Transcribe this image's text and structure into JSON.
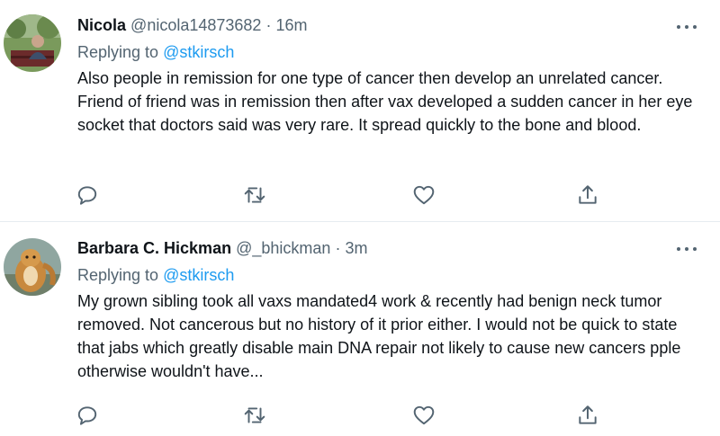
{
  "tweets": [
    {
      "name": "Nicola",
      "handle": "@nicola14873682",
      "separator": "·",
      "time": "16m",
      "replying_prefix": "Replying to",
      "replying_to": "@stkirsch",
      "text": "Also people in remission for one type of cancer then develop an unrelated cancer. Friend of friend was in remission then after vax developed a sudden cancer in her eye socket that doctors said was very rare. It spread quickly to the bone and blood.",
      "icons": {
        "more": "more-options-icon",
        "reply": "reply-icon",
        "retweet": "retweet-icon",
        "like": "heart-icon",
        "share": "share-icon"
      }
    },
    {
      "name": "Barbara C. Hickman",
      "handle": "@_bhickman",
      "separator": "·",
      "time": "3m",
      "replying_prefix": "Replying to",
      "replying_to": "@stkirsch",
      "text": "My grown sibling took all vaxs mandated4 work & recently had benign neck tumor removed. Not cancerous but no history of it prior either. I would not be quick to state that jabs which greatly disable main DNA repair not likely to cause new cancers pple otherwise wouldn't have...",
      "icons": {
        "more": "more-options-icon",
        "reply": "reply-icon",
        "retweet": "retweet-icon",
        "like": "heart-icon",
        "share": "share-icon"
      }
    }
  ],
  "colors": {
    "text": "#0f1419",
    "secondary": "#536471",
    "accent": "#1d9bf0",
    "divider": "#e6ecf0"
  }
}
